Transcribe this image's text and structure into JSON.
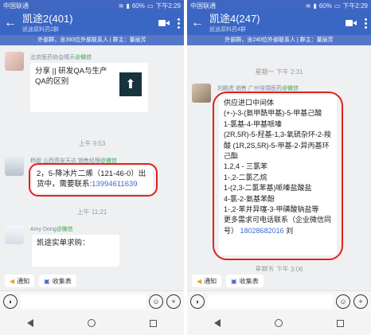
{
  "left": {
    "status": {
      "carrier": "中国联通",
      "signal": "60%",
      "time": "下午2:29"
    },
    "title": "凯途2(401)",
    "subtitle": "凯途原料药2群",
    "info": "外部群，含393位外部联系人 | 群主：董丽芳",
    "messages": {
      "m1": {
        "sender": "北京医药协会晴天",
        "wx": "@微信",
        "card_title": "分享 || 研发QA与生产QA的区别"
      },
      "t1": "上午 9:53",
      "m2": {
        "sender": "杨姐 山西高安天达 销售经理",
        "wx": "@微信",
        "text": "2，5-降冰片二烯（121-46-0）出货中，需要联系:",
        "phone": "13994611639"
      },
      "t2": "上午 11:21",
      "m3": {
        "sender": "Amy Dong",
        "wx": "@微信",
        "text": "凯途实单求购："
      }
    },
    "shortcuts": [
      "通知",
      "收集表"
    ]
  },
  "right": {
    "status": {
      "carrier": "中国联通",
      "signal": "60%",
      "time": "下午2:29"
    },
    "title": "凯途4(247)",
    "subtitle": "凯途原料药4群",
    "info": "外部群，含240位外部联系人 | 群主：董丽芳",
    "messages": {
      "t1": "星期一 下午 2:31",
      "m1": {
        "sender": "刘鹏虎 销售 广州倍瑞医药",
        "wx": "@微信",
        "lines": [
          "供应进口中间体",
          "(+-)-3-(氨甲酰甲基)-5-甲基己酸",
          "1-氯基-4-甲基哌嗪",
          "(2R,5R)-5-羟基-1,3-氧硫杂环-2-羧酸 (1R,2S,5R)-5-甲基-2-异丙基环己酯",
          "1,2,4 - 三氯苯",
          "1-,2-二氯乙烷",
          "1-(2,3-二氯苯基)哌嗪盐酸盐",
          "4-氯-2-氨基苯酚",
          "1-,2-苯并异噻-3-甲磺酸钠盐等",
          "更多需求可电话联系（企业微信同号）"
        ],
        "phone": "18028682016",
        "suffix": " 刘"
      },
      "t2": "星期五 下午 3:06"
    },
    "shortcuts": [
      "通知",
      "收集表"
    ]
  }
}
